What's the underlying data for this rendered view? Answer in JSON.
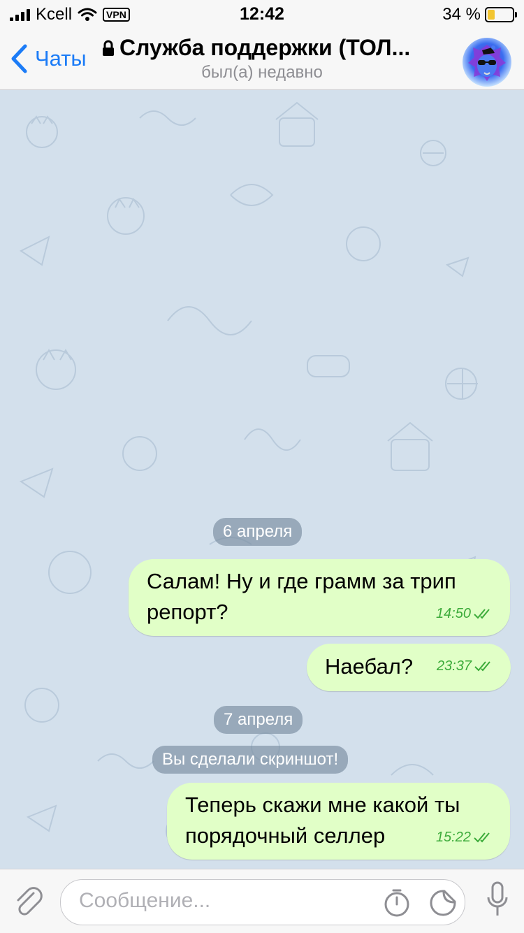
{
  "status_bar": {
    "carrier": "Kcell",
    "vpn": "VPN",
    "time": "12:42",
    "battery_percent": "34 %",
    "battery_level": 0.34
  },
  "header": {
    "back_label": "Чаты",
    "title": "Служба поддержки (ТОЛ...",
    "subtitle": "был(а) недавно",
    "lock_icon": "lock-icon",
    "back_icon": "chevron-left-icon"
  },
  "messages": [
    {
      "type": "date",
      "text": "6 апреля"
    },
    {
      "type": "outgoing",
      "text_lines": [
        "Салам! Ну и где грамм за трип",
        "репорт?"
      ],
      "time": "14:50",
      "status": "read"
    },
    {
      "type": "outgoing",
      "text_lines": [
        "Наебал?"
      ],
      "time": "23:37",
      "status": "read"
    },
    {
      "type": "date",
      "text": "7 апреля"
    },
    {
      "type": "service",
      "text": "Вы сделали скриншот!"
    },
    {
      "type": "outgoing",
      "text_lines": [
        "Теперь скажи мне какой ты",
        "порядочный селлер"
      ],
      "time": "15:22",
      "status": "read"
    }
  ],
  "input": {
    "placeholder": "Сообщение...",
    "icons": [
      "paperclip-icon",
      "timer-icon",
      "sticker-icon",
      "microphone-icon"
    ]
  },
  "colors": {
    "accent": "#1c7cf7",
    "outgoing_bubble": "#e1ffc7",
    "check_marks": "#3cab3a",
    "chat_background": "#d3e0ec"
  }
}
